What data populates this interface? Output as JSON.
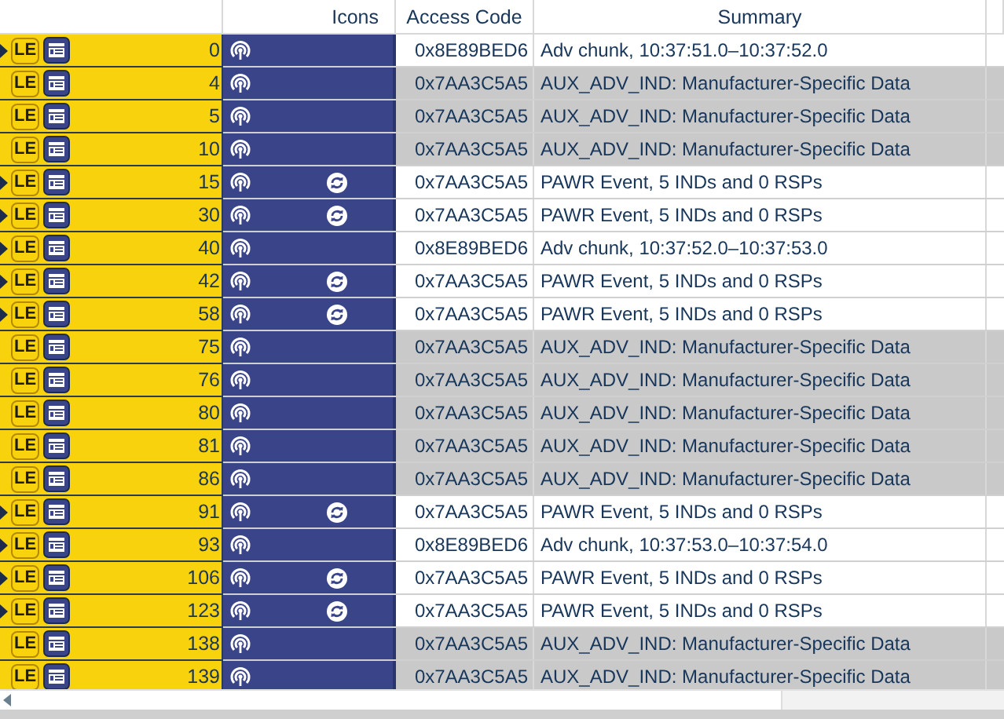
{
  "columns": [
    "Icons",
    "Access Code",
    "Summary"
  ],
  "rows": [
    {
      "expandable": true,
      "badge": "LE",
      "number": "0",
      "sync": false,
      "access_code": "0x8E89BED6",
      "summary": "Adv chunk, 10:37:51.0–10:37:52.0",
      "selected": false
    },
    {
      "expandable": false,
      "badge": "LE",
      "number": "4",
      "sync": false,
      "access_code": "0x7AA3C5A5",
      "summary": "AUX_ADV_IND: Manufacturer-Specific Data",
      "selected": true
    },
    {
      "expandable": false,
      "badge": "LE",
      "number": "5",
      "sync": false,
      "access_code": "0x7AA3C5A5",
      "summary": "AUX_ADV_IND: Manufacturer-Specific Data",
      "selected": true
    },
    {
      "expandable": false,
      "badge": "LE",
      "number": "10",
      "sync": false,
      "access_code": "0x7AA3C5A5",
      "summary": "AUX_ADV_IND: Manufacturer-Specific Data",
      "selected": true
    },
    {
      "expandable": true,
      "badge": "LE",
      "number": "15",
      "sync": true,
      "access_code": "0x7AA3C5A5",
      "summary": "PAWR Event, 5 INDs and 0 RSPs",
      "selected": false
    },
    {
      "expandable": true,
      "badge": "LE",
      "number": "30",
      "sync": true,
      "access_code": "0x7AA3C5A5",
      "summary": "PAWR Event, 5 INDs and 0 RSPs",
      "selected": false
    },
    {
      "expandable": true,
      "badge": "LE",
      "number": "40",
      "sync": false,
      "access_code": "0x8E89BED6",
      "summary": "Adv chunk, 10:37:52.0–10:37:53.0",
      "selected": false
    },
    {
      "expandable": true,
      "badge": "LE",
      "number": "42",
      "sync": true,
      "access_code": "0x7AA3C5A5",
      "summary": "PAWR Event, 5 INDs and 0 RSPs",
      "selected": false
    },
    {
      "expandable": true,
      "badge": "LE",
      "number": "58",
      "sync": true,
      "access_code": "0x7AA3C5A5",
      "summary": "PAWR Event, 5 INDs and 0 RSPs",
      "selected": false
    },
    {
      "expandable": false,
      "badge": "LE",
      "number": "75",
      "sync": false,
      "access_code": "0x7AA3C5A5",
      "summary": "AUX_ADV_IND: Manufacturer-Specific Data",
      "selected": true
    },
    {
      "expandable": false,
      "badge": "LE",
      "number": "76",
      "sync": false,
      "access_code": "0x7AA3C5A5",
      "summary": "AUX_ADV_IND: Manufacturer-Specific Data",
      "selected": true
    },
    {
      "expandable": false,
      "badge": "LE",
      "number": "80",
      "sync": false,
      "access_code": "0x7AA3C5A5",
      "summary": "AUX_ADV_IND: Manufacturer-Specific Data",
      "selected": true
    },
    {
      "expandable": false,
      "badge": "LE",
      "number": "81",
      "sync": false,
      "access_code": "0x7AA3C5A5",
      "summary": "AUX_ADV_IND: Manufacturer-Specific Data",
      "selected": true
    },
    {
      "expandable": false,
      "badge": "LE",
      "number": "86",
      "sync": false,
      "access_code": "0x7AA3C5A5",
      "summary": "AUX_ADV_IND: Manufacturer-Specific Data",
      "selected": true
    },
    {
      "expandable": true,
      "badge": "LE",
      "number": "91",
      "sync": true,
      "access_code": "0x7AA3C5A5",
      "summary": "PAWR Event, 5 INDs and 0 RSPs",
      "selected": false
    },
    {
      "expandable": true,
      "badge": "LE",
      "number": "93",
      "sync": false,
      "access_code": "0x8E89BED6",
      "summary": "Adv chunk, 10:37:53.0–10:37:54.0",
      "selected": false
    },
    {
      "expandable": true,
      "badge": "LE",
      "number": "106",
      "sync": true,
      "access_code": "0x7AA3C5A5",
      "summary": "PAWR Event, 5 INDs and 0 RSPs",
      "selected": false
    },
    {
      "expandable": true,
      "badge": "LE",
      "number": "123",
      "sync": true,
      "access_code": "0x7AA3C5A5",
      "summary": "PAWR Event, 5 INDs and 0 RSPs",
      "selected": false
    },
    {
      "expandable": false,
      "badge": "LE",
      "number": "138",
      "sync": false,
      "access_code": "0x7AA3C5A5",
      "summary": "AUX_ADV_IND: Manufacturer-Specific Data",
      "selected": true
    },
    {
      "expandable": false,
      "badge": "LE",
      "number": "139",
      "sync": false,
      "access_code": "0x7AA3C5A5",
      "summary": "AUX_ADV_IND: Manufacturer-Specific Data",
      "selected": true
    }
  ]
}
